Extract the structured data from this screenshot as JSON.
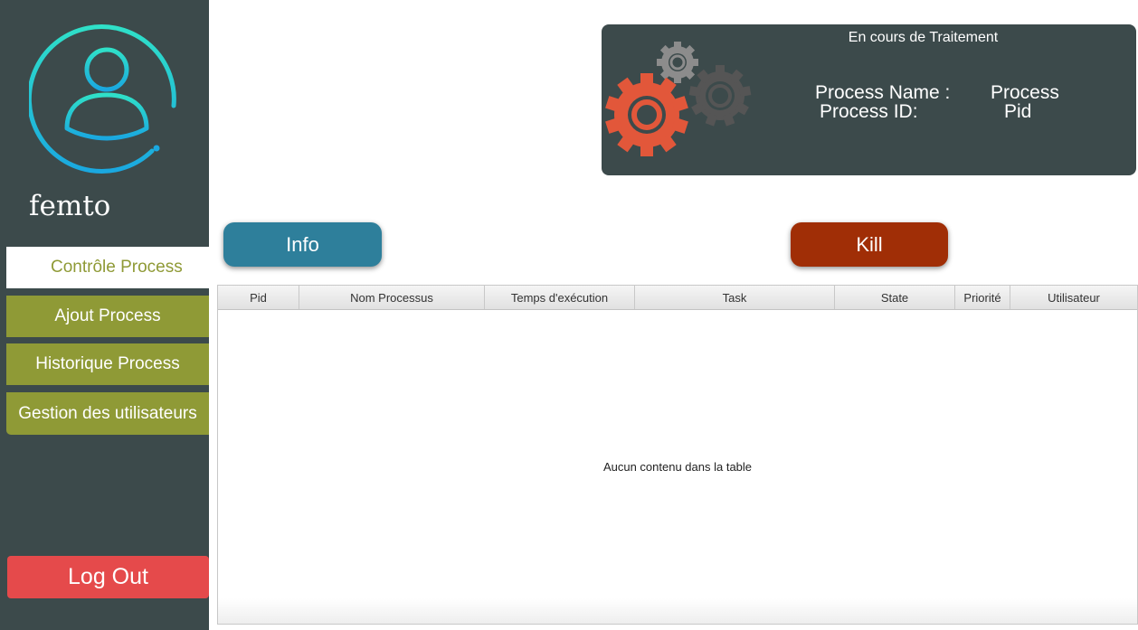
{
  "sidebar": {
    "username": "femto",
    "items": [
      {
        "label": "Contrôle Process",
        "active": true
      },
      {
        "label": "Ajout Process",
        "active": false
      },
      {
        "label": "Historique Process",
        "active": false
      },
      {
        "label": "Gestion des utilisateurs",
        "active": false
      }
    ],
    "logout_label": "Log Out",
    "avatar_icon": "user-avatar-icon"
  },
  "status_panel": {
    "title": "En cours de Traitement",
    "process_name_label": "Process Name :",
    "process_name_value": "Process",
    "process_id_label": "Process ID:",
    "process_id_value": "Pid",
    "gears_icon": "gears-icon"
  },
  "actions": {
    "info_label": "Info",
    "kill_label": "Kill"
  },
  "table": {
    "columns": [
      "Pid",
      "Nom Processus",
      "Temps d'exécution",
      "Task",
      "State",
      "Priorité",
      "Utilisateur"
    ],
    "rows": [],
    "empty_message": "Aucun contenu dans la table"
  },
  "colors": {
    "sidebar_bg": "#3c4a4b",
    "nav_olive": "#8f9a36",
    "logout_red": "#e54a4b",
    "info_blue": "#2e7f9b",
    "kill_red": "#a02e06",
    "gear_orange": "#e2573a"
  }
}
